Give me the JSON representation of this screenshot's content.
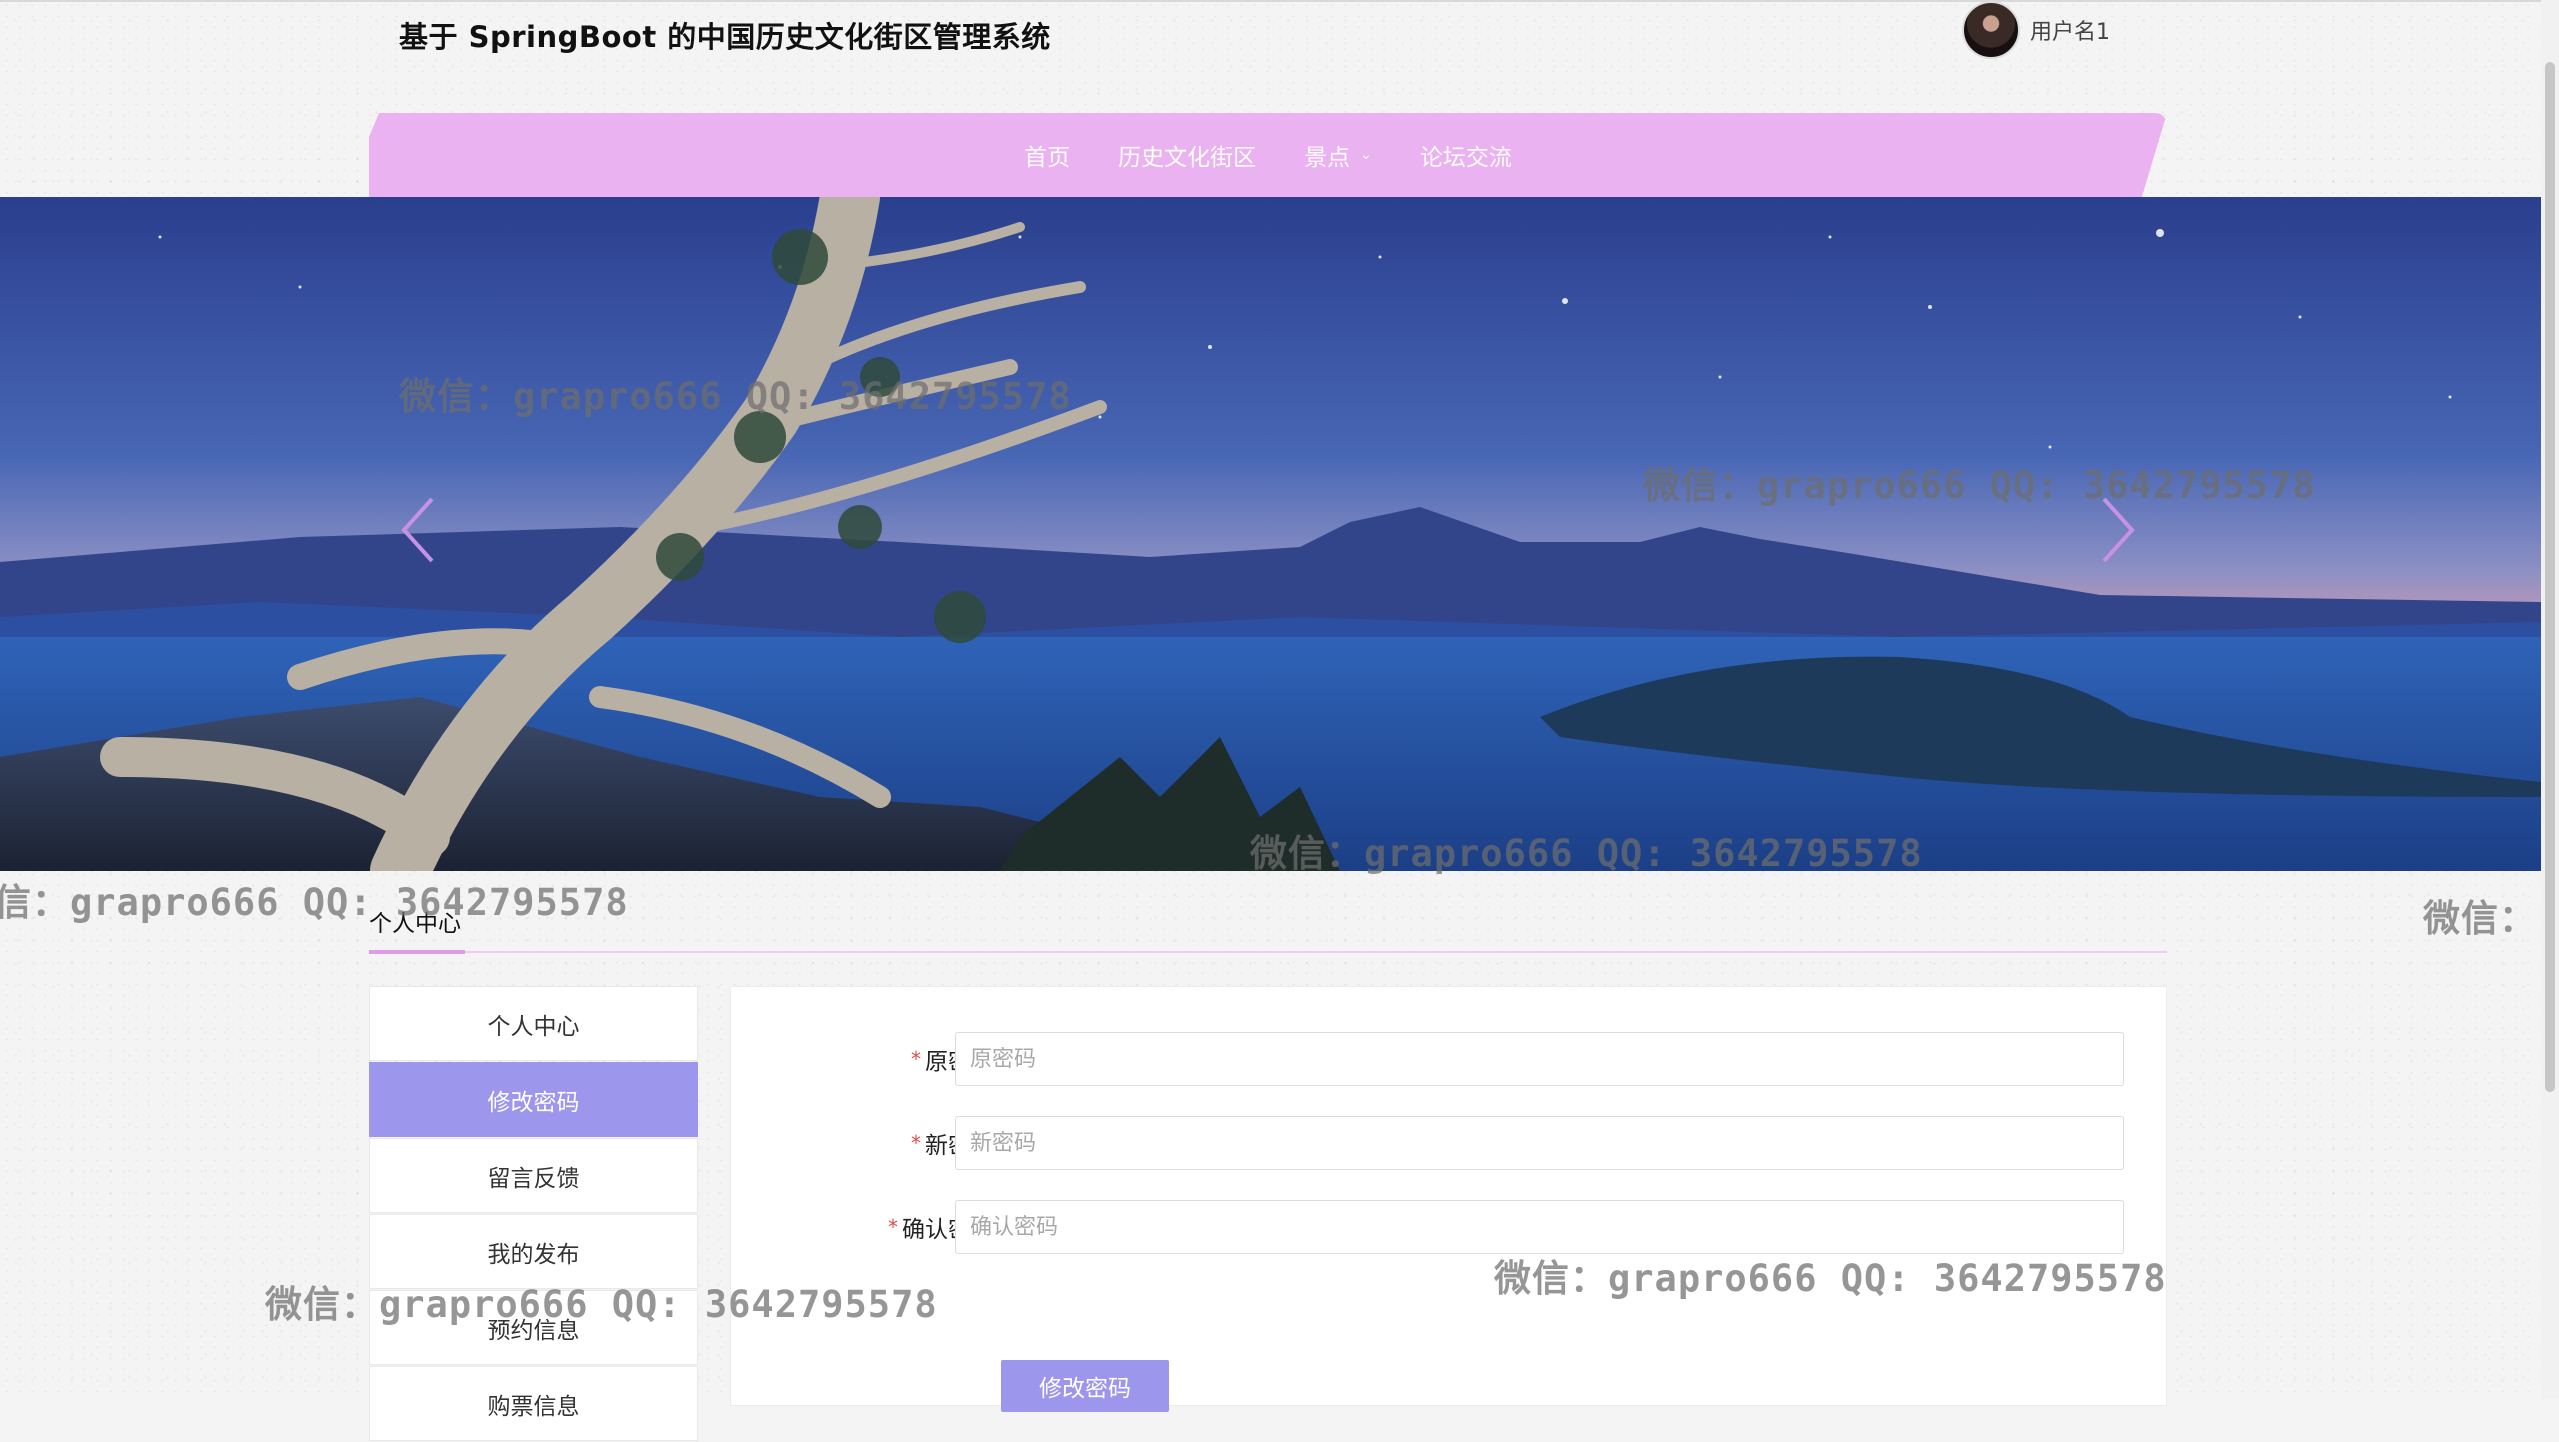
{
  "header": {
    "site_title": "基于 SpringBoot 的中国历史文化街区管理系统",
    "username": "用户名1"
  },
  "nav": {
    "items": [
      {
        "label": "首页"
      },
      {
        "label": "历史文化街区"
      },
      {
        "label": "景点",
        "has_dropdown": true
      },
      {
        "label": "论坛交流"
      }
    ],
    "color": "#ebb2f1"
  },
  "carousel": {
    "prev_icon": "chevron-left-icon",
    "next_icon": "chevron-right-icon",
    "image_description_icon": "banner-landscape"
  },
  "section": {
    "title": "个人中心"
  },
  "sidebar": {
    "items": [
      {
        "label": "个人中心",
        "active": false
      },
      {
        "label": "修改密码",
        "active": true
      },
      {
        "label": "留言反馈",
        "active": false
      },
      {
        "label": "我的发布",
        "active": false
      },
      {
        "label": "预约信息",
        "active": false
      },
      {
        "label": "购票信息",
        "active": false
      }
    ],
    "active_color": "#9c96ec"
  },
  "form": {
    "old_password": {
      "label": "原密码",
      "placeholder": "原密码",
      "value": ""
    },
    "new_password": {
      "label": "新密码",
      "placeholder": "新密码",
      "value": ""
    },
    "confirm_password": {
      "label": "确认密码",
      "placeholder": "确认密码",
      "value": ""
    },
    "required_mark": "*",
    "submit_label": "修改密码"
  },
  "watermarks": [
    "微信：grapro666 QQ: 3642795578",
    "微信：grapro666 QQ: 3642795578",
    "微信：grapro666 QQ: 3642795578",
    "信：grapro666 QQ: 3642795578",
    "微信：",
    "微信：grapro666 QQ: 3642795578",
    "微信：grapro666 QQ: 3642795578"
  ]
}
